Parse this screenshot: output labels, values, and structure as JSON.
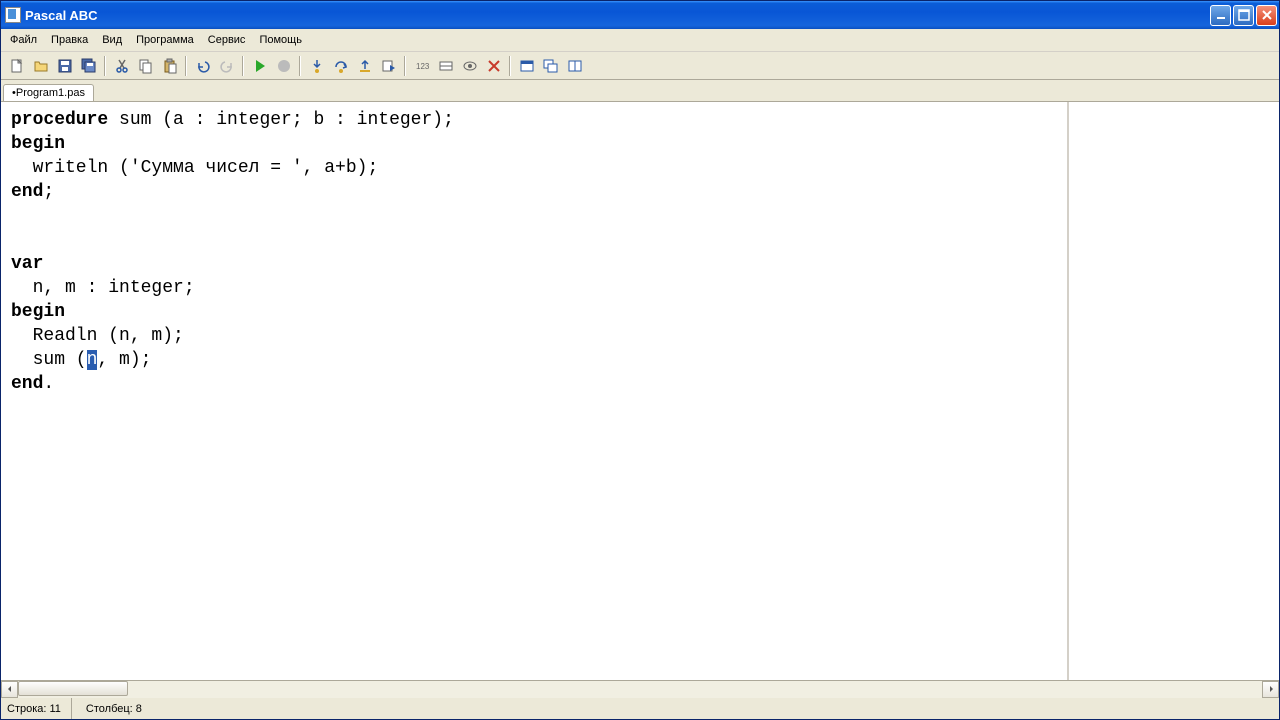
{
  "window": {
    "title": "Pascal ABC"
  },
  "menu": {
    "file": "Файл",
    "edit": "Правка",
    "view": "Вид",
    "program": "Программа",
    "service": "Сервис",
    "help": "Помощь"
  },
  "tabs": {
    "active": "•Program1.pas"
  },
  "code": {
    "l1a": "procedure",
    "l1b": " sum (a : integer; b : integer);",
    "l2": "begin",
    "l3a": "  writeln (",
    "l3b": "'Сумма чисел = '",
    "l3c": ", a+b);",
    "l4": "end",
    "l4b": ";",
    "l7": "var",
    "l8": "  n, m : integer;",
    "l9": "begin",
    "l10": "  Readln (n, m);",
    "l11a": "  sum (",
    "l11sel": "n",
    "l11b": ", m);",
    "l12": "end",
    "l12b": "."
  },
  "status": {
    "line": "Строка: 11",
    "col": "Столбец: 8"
  }
}
